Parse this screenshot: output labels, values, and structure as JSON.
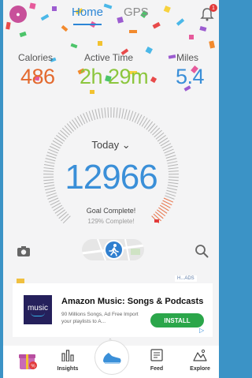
{
  "header": {
    "tabs": [
      {
        "label": "Home"
      },
      {
        "label": "GPS"
      }
    ],
    "notification_count": "1"
  },
  "stats": {
    "calories": {
      "label": "Calories",
      "value": "486"
    },
    "active_time": {
      "label": "Active Time",
      "value": "2h 29m"
    },
    "miles": {
      "label": "Miles",
      "value": "5.4"
    }
  },
  "progress": {
    "period": "Today",
    "steps": "12966",
    "status": "Goal Complete!",
    "percent_text": "129% Complete!",
    "percent": 129
  },
  "ad": {
    "logo_text": "music",
    "title": "Amazon Music: Songs & Podcasts",
    "description": "90 Millions Songs, Ad Free Import your playlists to A...",
    "button": "INSTALL",
    "choice_label": "H...ADS"
  },
  "bottom_nav": {
    "items": [
      {
        "label": "",
        "icon": "gift-icon"
      },
      {
        "label": "Insights",
        "icon": "bar-chart-icon"
      },
      {
        "label": "",
        "icon": "shoe-icon"
      },
      {
        "label": "Feed",
        "icon": "feed-icon"
      },
      {
        "label": "Explore",
        "icon": "explore-icon"
      }
    ]
  },
  "colors": {
    "accent": "#3a8fd8",
    "calories": "#e36a2f",
    "active": "#8cc63e",
    "install": "#2ba64a"
  }
}
